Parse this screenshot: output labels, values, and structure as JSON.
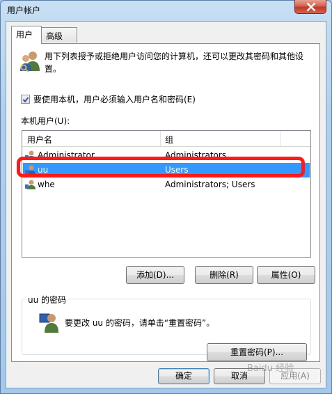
{
  "window": {
    "title": "用户帐户"
  },
  "tabs": [
    {
      "label": "用户",
      "active": true
    },
    {
      "label": "高级",
      "active": false
    }
  ],
  "intro": {
    "text": "用下列表授予或拒绝用户访问您的计算机，还可以更改其密码和其他设置。"
  },
  "login_required": {
    "label": "要使用本机，用户必须输入用户名和密码(E)",
    "checked": true
  },
  "users_section": {
    "label": "本机用户(U):",
    "columns": [
      "用户名",
      "组"
    ],
    "rows": [
      {
        "name": "Administrator",
        "group": "Administrators",
        "selected": false
      },
      {
        "name": "uu",
        "group": "Users",
        "selected": true
      },
      {
        "name": "whe",
        "group": "Administrators; Users",
        "selected": false
      }
    ]
  },
  "user_buttons": {
    "add": "添加(D)...",
    "remove": "删除(R)",
    "properties": "属性(O)"
  },
  "password_group": {
    "title": "uu 的密码",
    "text": "要更改 uu 的密码，请单击“重置密码”。",
    "reset_button": "重置密码(P)..."
  },
  "dialog_buttons": {
    "ok": "确定",
    "cancel": "取消",
    "apply": "应用(A)"
  },
  "watermark": "Baidu 经验",
  "colors": {
    "selection": "#3399ff",
    "annotation": "#ff1a1a"
  }
}
